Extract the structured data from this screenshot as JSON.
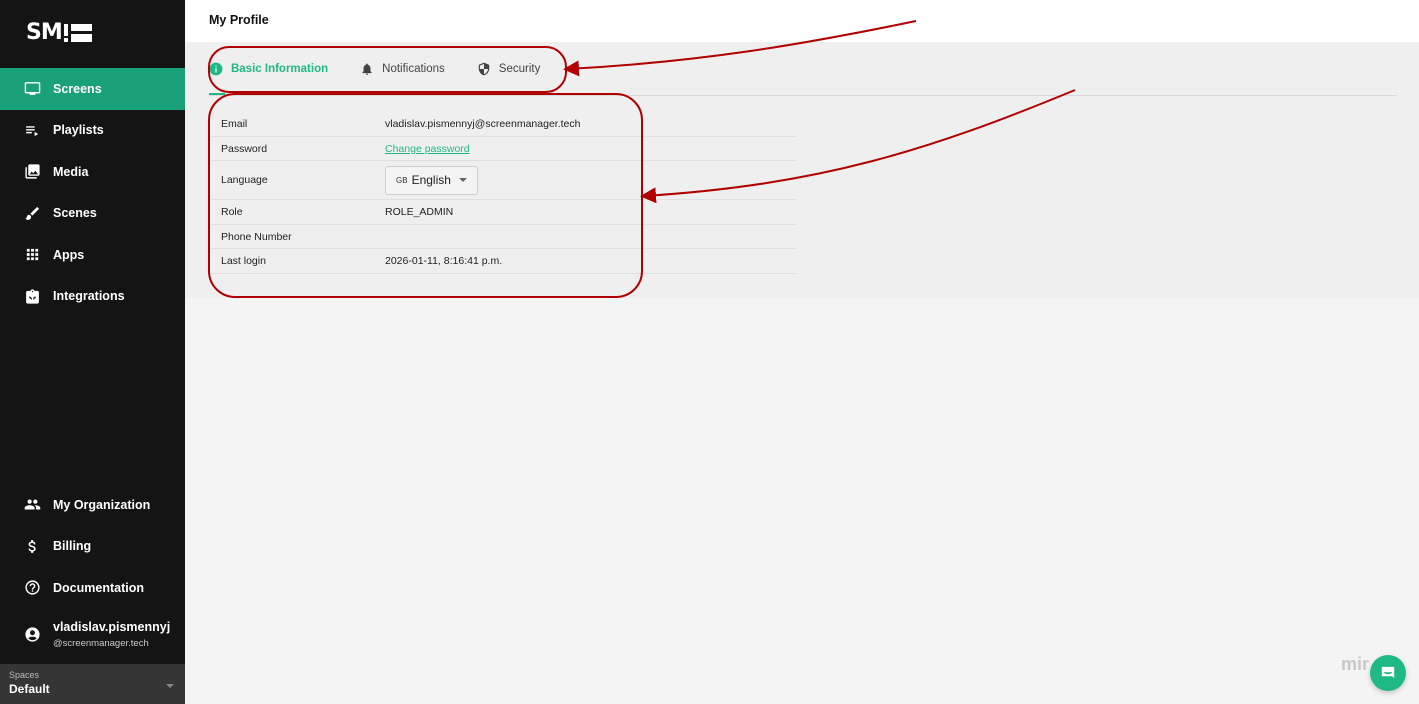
{
  "logo": {
    "text": "SM"
  },
  "header": {
    "title": "My Profile"
  },
  "sidebar": {
    "items": [
      {
        "label": "Screens",
        "icon": "monitor-icon",
        "active": true
      },
      {
        "label": "Playlists",
        "icon": "playlist-icon"
      },
      {
        "label": "Media",
        "icon": "media-icon"
      },
      {
        "label": "Scenes",
        "icon": "brush-icon"
      },
      {
        "label": "Apps",
        "icon": "apps-grid-icon"
      },
      {
        "label": "Integrations",
        "icon": "integrations-icon"
      }
    ],
    "bottom": [
      {
        "label": "My Organization",
        "icon": "people-icon"
      },
      {
        "label": "Billing",
        "icon": "dollar-icon"
      },
      {
        "label": "Documentation",
        "icon": "help-icon"
      }
    ],
    "user": {
      "name": "vladislav.pismennyj",
      "domain": "@screenmanager.tech"
    },
    "spaces": {
      "label": "Spaces",
      "value": "Default"
    }
  },
  "tabs": [
    {
      "label": "Basic Information",
      "icon": "info-icon",
      "active": true
    },
    {
      "label": "Notifications",
      "icon": "bell-icon"
    },
    {
      "label": "Security",
      "icon": "shield-icon"
    }
  ],
  "profile": {
    "email_label": "Email",
    "email_value": "vladislav.pismennyj@screenmanager.tech",
    "password_label": "Password",
    "password_link": "Change password",
    "language_label": "Language",
    "language_flag": "GB",
    "language_value": "English",
    "role_label": "Role",
    "role_value": "ROLE_ADMIN",
    "phone_label": "Phone Number",
    "phone_value": "",
    "last_login_label": "Last login",
    "last_login_value": "2026-01-11, 8:16:41 p.m."
  },
  "watermark": "mir",
  "colors": {
    "accent": "#1fb985",
    "sidebar_bg": "#141414",
    "active_nav": "#1aa07a",
    "annotation": "#b00000"
  }
}
